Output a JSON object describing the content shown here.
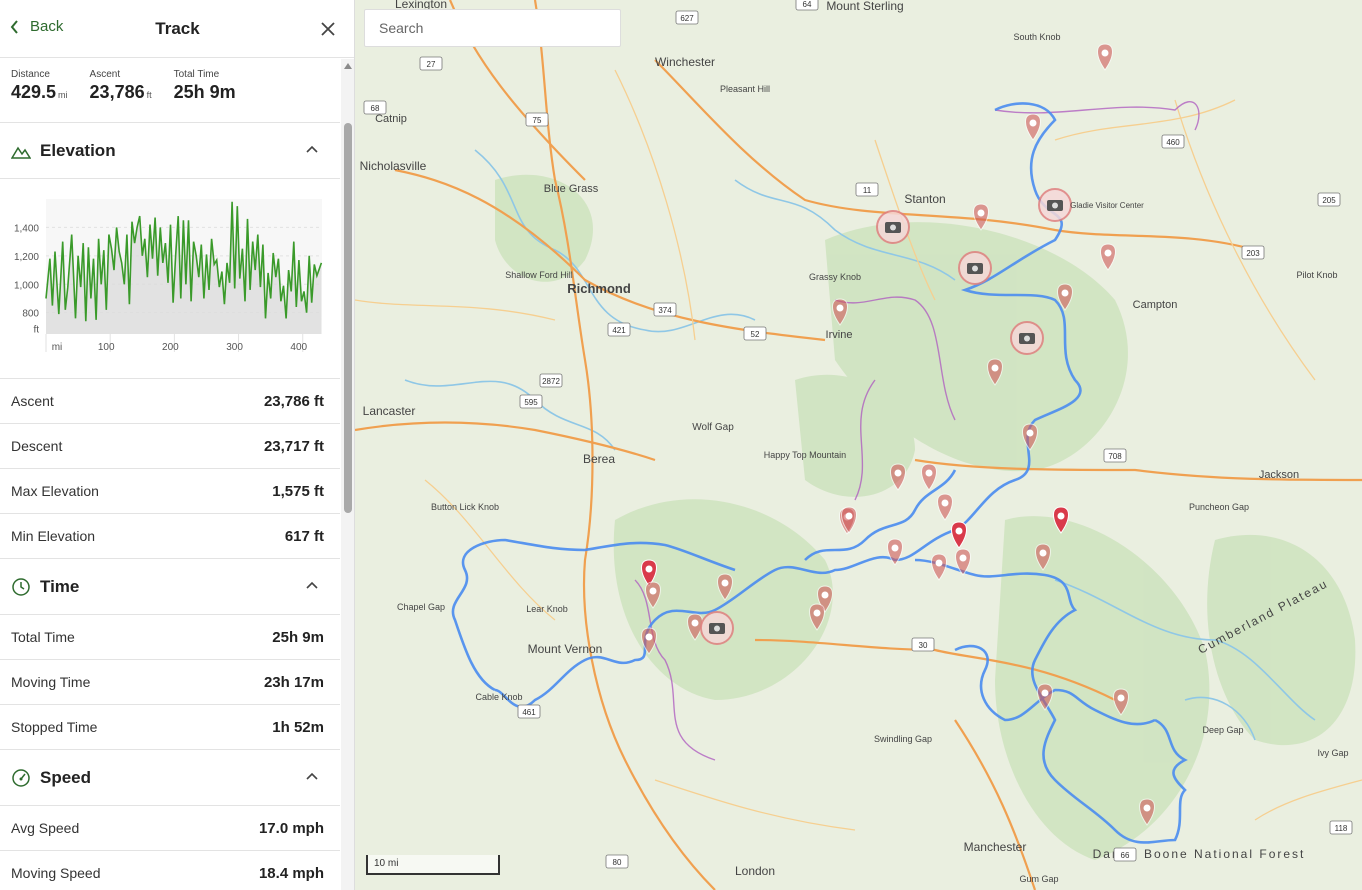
{
  "header": {
    "back_label": "Back",
    "title": "Track"
  },
  "summary": [
    {
      "label": "Distance",
      "value": "429.5",
      "unit": "mi"
    },
    {
      "label": "Ascent",
      "value": "23,786",
      "unit": "ft"
    },
    {
      "label": "Total Time",
      "value": "25h 9m",
      "unit": ""
    }
  ],
  "elevation": {
    "title": "Elevation",
    "chart_data": {
      "type": "area",
      "xlabel": "mi",
      "ylabel": "ft",
      "x_ticks": [
        "mi",
        "100",
        "200",
        "300",
        "400"
      ],
      "y_ticks": [
        "1,400",
        "1,200",
        "1,000",
        "800"
      ],
      "xlim": [
        0,
        430
      ],
      "ylim": [
        650,
        1600
      ],
      "series": [
        {
          "x": [
            0,
            6,
            10,
            14,
            20,
            26,
            30,
            34,
            40,
            46,
            50,
            54,
            58,
            62,
            66,
            70,
            74,
            78,
            82,
            86,
            90,
            94,
            98,
            102,
            106,
            110,
            114,
            118,
            122,
            126,
            130,
            134,
            138,
            142,
            146,
            150,
            154,
            158,
            162,
            166,
            170,
            174,
            178,
            182,
            186,
            190,
            194,
            198,
            202,
            206,
            210,
            214,
            218,
            222,
            226,
            230,
            234,
            238,
            242,
            246,
            250,
            254,
            258,
            262,
            266,
            270,
            274,
            278,
            282,
            286,
            290,
            294,
            298,
            302,
            306,
            310,
            314,
            318,
            322,
            326,
            330,
            334,
            338,
            342,
            346,
            350,
            354,
            358,
            362,
            366,
            370,
            374,
            378,
            382,
            386,
            390,
            394,
            398,
            402,
            406,
            410,
            414,
            418,
            422,
            429
          ],
          "values": [
            900,
            1180,
            850,
            1230,
            790,
            1300,
            820,
            980,
            1350,
            760,
            1200,
            980,
            1290,
            740,
            1260,
            900,
            1180,
            750,
            1320,
            1000,
            1240,
            820,
            1350,
            1250,
            1100,
            1400,
            1230,
            1150,
            1000,
            1350,
            860,
            1440,
            1290,
            1400,
            1480,
            1200,
            1320,
            1050,
            1420,
            1180,
            1470,
            1060,
            1400,
            1150,
            1290,
            1010,
            1420,
            870,
            1210,
            1480,
            900,
            1450,
            1000,
            1450,
            880,
            1300,
            1200,
            1050,
            1280,
            900,
            1210,
            960,
            1320,
            1140,
            1170,
            980,
            1090,
            860,
            1150,
            1010,
            1580,
            970,
            1550,
            1040,
            1250,
            880,
            1460,
            960,
            1300,
            1100,
            1350,
            980,
            1280,
            760,
            1080,
            900,
            1220,
            1050,
            1180,
            880,
            990,
            760,
            1100,
            950,
            1300,
            840,
            1170,
            880,
            950,
            800,
            1200,
            870,
            1140,
            1060,
            1150
          ]
        }
      ]
    }
  },
  "elevation_stats": [
    {
      "label": "Ascent",
      "value": "23,786 ft"
    },
    {
      "label": "Descent",
      "value": "23,717 ft"
    },
    {
      "label": "Max Elevation",
      "value": "1,575 ft"
    },
    {
      "label": "Min Elevation",
      "value": "617 ft"
    }
  ],
  "time": {
    "title": "Time",
    "stats": [
      {
        "label": "Total Time",
        "value": "25h 9m"
      },
      {
        "label": "Moving Time",
        "value": "23h 17m"
      },
      {
        "label": "Stopped Time",
        "value": "1h 52m"
      }
    ]
  },
  "speed": {
    "title": "Speed",
    "stats": [
      {
        "label": "Avg Speed",
        "value": "17.0 mph"
      },
      {
        "label": "Moving Speed",
        "value": "18.4 mph"
      }
    ]
  },
  "map": {
    "search_placeholder": "Search",
    "scale_label": "10 mi",
    "places": [
      "Lexington",
      "Mount Sterling",
      "Winchester",
      "Catnip",
      "Nicholasville",
      "Blue Grass",
      "Richmond",
      "Stanton",
      "Irvine",
      "Campton",
      "Lancaster",
      "Berea",
      "Wolf Gap",
      "Jackson",
      "Mount Vernon",
      "Manchester",
      "London",
      "Pleasant Hill",
      "Shallow Ford Hill",
      "Grassy Knob",
      "Happy Top Mountain",
      "Button Lick Knob",
      "Lear Knob",
      "Cable Knob",
      "South Knob",
      "Pilot Knob",
      "Gladie Visitor Center",
      "Chapel Gap",
      "Puncheon Gap",
      "Deep Gap",
      "Ivy Gap",
      "Swindling Gap",
      "Gum Gap",
      "Daniel Boone National Forest",
      "Cumberland Plateau"
    ],
    "route_shields": [
      "627",
      "27",
      "68",
      "75",
      "11",
      "460",
      "205",
      "203",
      "374",
      "421",
      "52",
      "2872",
      "595",
      "708",
      "461",
      "30",
      "118",
      "66",
      "80",
      "64"
    ],
    "colors": {
      "route": "#4a8cf0",
      "alt_route": "#b060c0",
      "elevation_line": "#3a9a2a",
      "accent": "#2e6b2e",
      "marker": "#d05a5a"
    }
  }
}
